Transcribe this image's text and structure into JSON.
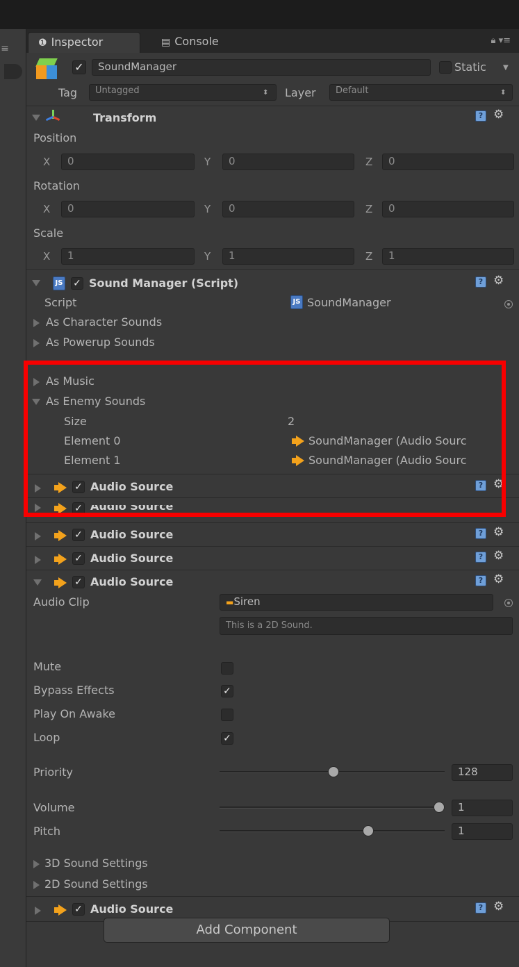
{
  "tabs": {
    "inspector": "Inspector",
    "console": "Console"
  },
  "gameobject": {
    "name": "SoundManager",
    "static_label": "Static",
    "tag_label": "Tag",
    "tag_value": "Untagged",
    "layer_label": "Layer",
    "layer_value": "Default"
  },
  "transform": {
    "title": "Transform",
    "position_label": "Position",
    "rotation_label": "Rotation",
    "scale_label": "Scale",
    "x_label": "X",
    "y_label": "Y",
    "z_label": "Z",
    "position": {
      "x": "0",
      "y": "0",
      "z": "0"
    },
    "rotation": {
      "x": "0",
      "y": "0",
      "z": "0"
    },
    "scale": {
      "x": "1",
      "y": "1",
      "z": "1"
    }
  },
  "script_component": {
    "title": "Sound Manager (Script)",
    "script_label": "Script",
    "script_value": "SoundManager",
    "char_sounds": "As Character Sounds",
    "powerup_sounds": "As Powerup Sounds",
    "music": "As Music",
    "enemy_sounds": "As Enemy Sounds",
    "size_label": "Size",
    "size_value": "2",
    "element0_label": "Element 0",
    "element0_value": "SoundManager (Audio Sourc",
    "element1_label": "Element 1",
    "element1_value": "SoundManager (Audio Sourc"
  },
  "audio_source_title": "Audio Source",
  "audio_source": {
    "clip_label": "Audio Clip",
    "clip_value": "Siren",
    "info": "This is a 2D Sound.",
    "mute_label": "Mute",
    "mute": false,
    "bypass_label": "Bypass Effects",
    "bypass": true,
    "play_on_awake_label": "Play On Awake",
    "play_on_awake": false,
    "loop_label": "Loop",
    "loop": true,
    "priority_label": "Priority",
    "priority_value": "128",
    "volume_label": "Volume",
    "volume_value": "1",
    "pitch_label": "Pitch",
    "pitch_value": "1",
    "sound3d": "3D Sound Settings",
    "sound2d": "2D Sound Settings"
  },
  "add_component": "Add Component",
  "colors": {
    "highlight": "#f80000",
    "speaker": "#f3a21c",
    "panel": "#393939"
  }
}
